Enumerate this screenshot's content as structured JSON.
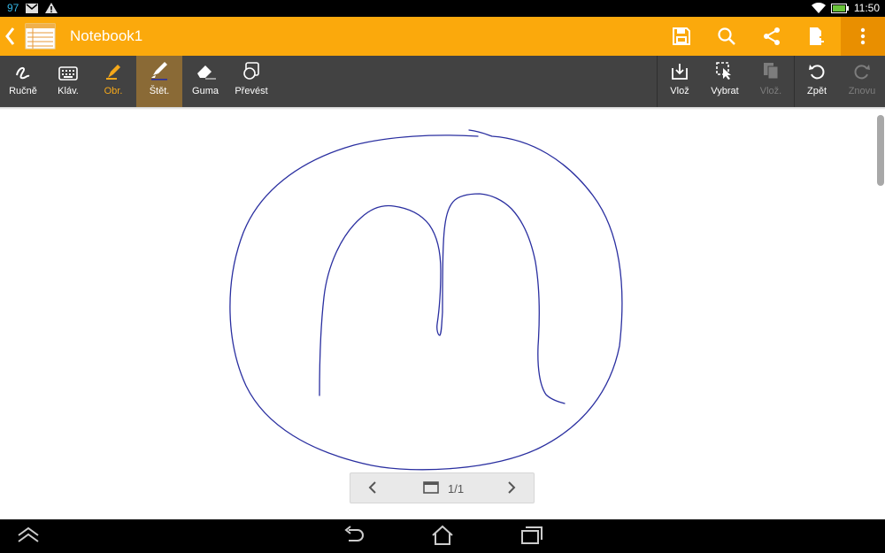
{
  "status": {
    "notification_count": "97",
    "time": "11:50",
    "icons": [
      "gmail-icon",
      "warning-icon",
      "wifi-icon",
      "battery-icon"
    ]
  },
  "appbar": {
    "title": "Notebook1",
    "actions": [
      "save-icon",
      "search-icon",
      "share-icon",
      "add-page-icon",
      "more-icon"
    ],
    "accent": "#fba90c"
  },
  "toolbar": {
    "tools": [
      {
        "label": "Ručně",
        "icon": "handwriting-icon"
      },
      {
        "label": "Kláv.",
        "icon": "keyboard-icon"
      },
      {
        "label": "Obr.",
        "icon": "highlighter-icon"
      },
      {
        "label": "Štět.",
        "icon": "brush-icon",
        "active": true
      },
      {
        "label": "Guma",
        "icon": "eraser-icon"
      },
      {
        "label": "Převést",
        "icon": "convert-icon"
      }
    ],
    "actions": [
      {
        "label": "Vlož",
        "icon": "import-icon"
      },
      {
        "label": "Vybrat",
        "icon": "select-icon"
      },
      {
        "label": "Vlož.",
        "icon": "paste-icon",
        "disabled": true
      },
      {
        "label": "Zpět",
        "icon": "undo-icon"
      },
      {
        "label": "Znovu",
        "icon": "redo-icon",
        "disabled": true
      }
    ]
  },
  "pager": {
    "page_text": "1/1"
  },
  "ink": {
    "color": "#2a2fa0"
  }
}
